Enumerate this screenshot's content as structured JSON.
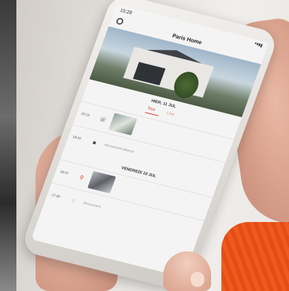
{
  "phone": {
    "status_time": "15:28",
    "app_title": "Paris Home",
    "sections": [
      {
        "title": "HIER, 11 JUL"
      },
      {
        "title": "VENDREDI 10 JUL"
      }
    ],
    "tabs": [
      {
        "label": "Tout",
        "active": true
      },
      {
        "label": "Live",
        "active": false
      }
    ],
    "events": [
      {
        "time": "20:15",
        "icon": "phone-icon",
        "text": ""
      },
      {
        "time": "19:42",
        "icon": "camera-icon",
        "text": "Mouvement détecté"
      },
      {
        "time": "18:07",
        "icon": "pin-icon",
        "text": ""
      },
      {
        "time": "17:30",
        "icon": "bell-icon",
        "text": "Mouvement"
      }
    ]
  },
  "colors": {
    "accent": "#d23b2b",
    "sleeve": "#f05a1d"
  }
}
